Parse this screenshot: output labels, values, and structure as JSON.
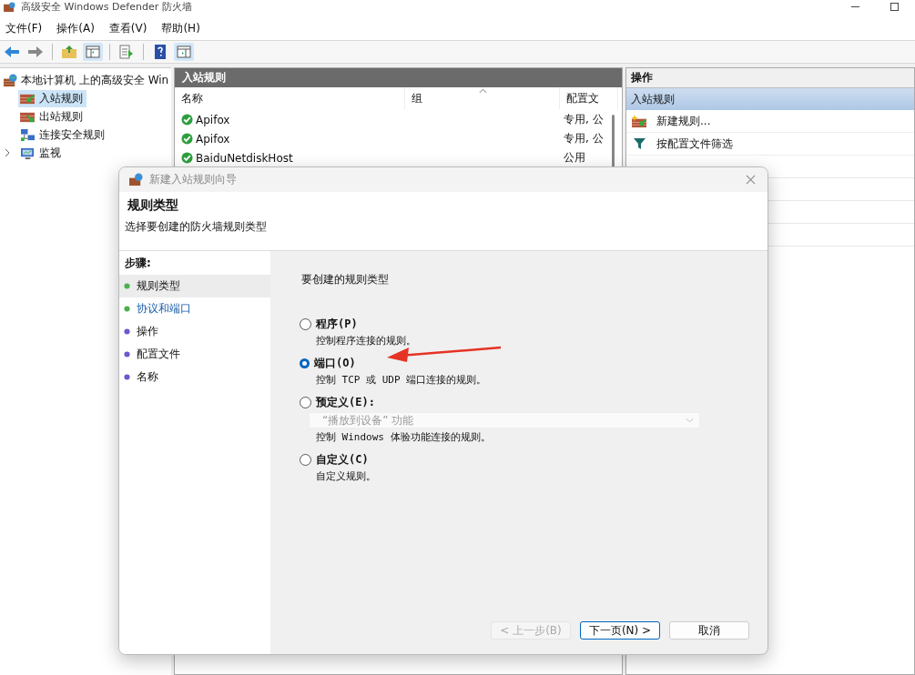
{
  "window": {
    "title": "高级安全 Windows Defender 防火墙"
  },
  "menu": [
    "文件(F)",
    "操作(A)",
    "查看(V)",
    "帮助(H)"
  ],
  "tree": {
    "label": "本地计算机 上的高级安全 Win",
    "children": [
      {
        "label": "入站规则",
        "kind": "inbound",
        "selected": true,
        "expandable": false
      },
      {
        "label": "出站规则",
        "kind": "outbound",
        "selected": false,
        "expandable": false
      },
      {
        "label": "连接安全规则",
        "kind": "security",
        "selected": false,
        "expandable": false
      },
      {
        "label": "监视",
        "kind": "monitor",
        "selected": false,
        "expandable": true
      }
    ]
  },
  "rules": {
    "title": "入站规则",
    "columns": [
      {
        "label": "名称",
        "sorted": false
      },
      {
        "label": "组",
        "sorted": true
      },
      {
        "label": "配置文",
        "sorted": false
      }
    ],
    "rows": [
      {
        "name": "Apifox",
        "profile": "专用, 公",
        "enabled": true
      },
      {
        "name": "Apifox",
        "profile": "专用, 公",
        "enabled": true
      },
      {
        "name": "BaiduNetdiskHost",
        "profile": "公用",
        "enabled": true
      }
    ]
  },
  "actions": {
    "title": "操作",
    "section": "入站规则",
    "items": [
      {
        "label": "新建规则...",
        "kind": "new"
      },
      {
        "label": "按配置文件筛选",
        "kind": "filter"
      }
    ]
  },
  "dialog": {
    "title": "新建入站规则向导",
    "heading": "规则类型",
    "subheading": "选择要创建的防火墙规则类型",
    "steps_title": "步骤:",
    "steps": [
      {
        "label": "规则类型",
        "selected": true,
        "hovered": false,
        "color": "#4caf50"
      },
      {
        "label": "协议和端口",
        "selected": false,
        "hovered": true,
        "color": "#4caf50"
      },
      {
        "label": "操作",
        "selected": false,
        "hovered": false,
        "color": "#6a5acd"
      },
      {
        "label": "配置文件",
        "selected": false,
        "hovered": false,
        "color": "#6a5acd"
      },
      {
        "label": "名称",
        "selected": false,
        "hovered": false,
        "color": "#6a5acd"
      }
    ],
    "prompt": "要创建的规则类型",
    "options": [
      {
        "label": "程序(P)",
        "selected": false,
        "description": "控制程序连接的规则。"
      },
      {
        "label": "端口(O)",
        "selected": true,
        "description": "控制 TCP 或 UDP 端口连接的规则。"
      },
      {
        "label": "预定义(E):",
        "selected": false,
        "dropdown": {
          "value": "“播放到设备” 功能",
          "disabled": true
        },
        "description": "控制 Windows 体验功能连接的规则。"
      },
      {
        "label": "自定义(C)",
        "selected": false,
        "description": "自定义规则。"
      }
    ],
    "buttons": [
      {
        "label": "< 上一步(B)",
        "disabled": true,
        "primary": false
      },
      {
        "label": "下一页(N) >",
        "disabled": false,
        "primary": true
      },
      {
        "label": "取消",
        "disabled": false,
        "primary": false
      }
    ]
  }
}
